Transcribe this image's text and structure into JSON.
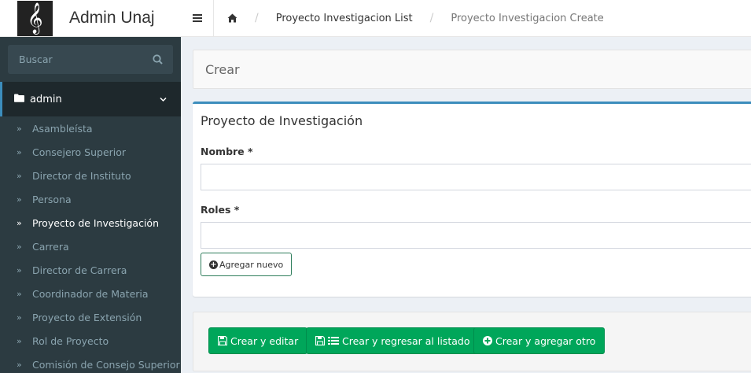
{
  "app": {
    "title": "Admin Unaj",
    "logo_glyph": "𝄞"
  },
  "breadcrumb": {
    "items": [
      {
        "label": "Proyecto Investigacion List"
      },
      {
        "label": "Proyecto Investigacion Create"
      }
    ],
    "separator": "/"
  },
  "sidebar": {
    "search": {
      "placeholder": "Buscar",
      "value": ""
    },
    "section": {
      "label": "admin"
    },
    "items": [
      {
        "label": "Asambleísta"
      },
      {
        "label": "Consejero Superior"
      },
      {
        "label": "Director de Instituto"
      },
      {
        "label": "Persona"
      },
      {
        "label": "Proyecto de Investigación"
      },
      {
        "label": "Carrera"
      },
      {
        "label": "Director de Carrera"
      },
      {
        "label": "Coordinador de Materia"
      },
      {
        "label": "Proyecto de Extensión"
      },
      {
        "label": "Rol de Proyecto"
      },
      {
        "label": "Comisión de Consejo Superior"
      }
    ],
    "active_index": 4
  },
  "page": {
    "title": "Crear"
  },
  "form": {
    "heading": "Proyecto de Investigación",
    "fields": [
      {
        "label": "Nombre *",
        "value": ""
      },
      {
        "label": "Roles *",
        "value": ""
      }
    ],
    "add_new_label": "Agregar nuevo"
  },
  "actions": {
    "create_edit": "Crear y editar",
    "create_return": "Crear y regresar al listado",
    "create_add": "Crear y agregar otro"
  },
  "colors": {
    "sidebar_bg": "#2c3b41",
    "sidebar_active_bg": "#1e282c",
    "accent": "#3c8dbc",
    "success": "#00a65a"
  }
}
